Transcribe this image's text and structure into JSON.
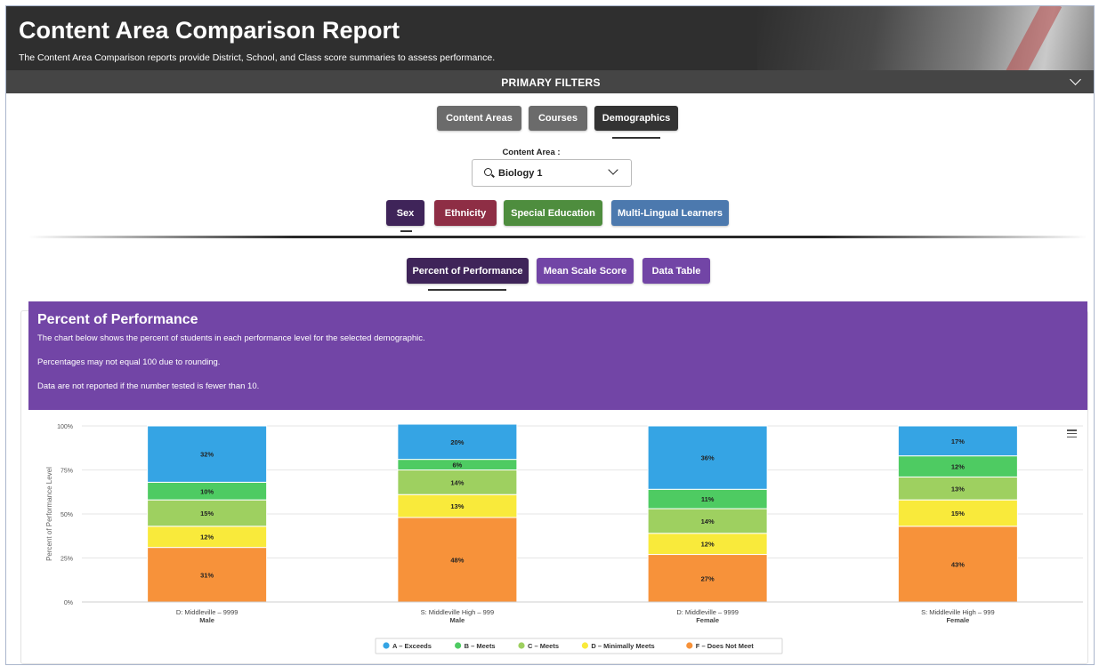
{
  "header": {
    "title": "Content Area Comparison Report",
    "subtitle": "The Content Area Comparison reports provide District, School, and Class score summaries to assess performance."
  },
  "filters": {
    "label": "PRIMARY FILTERS"
  },
  "tabs": {
    "content_areas": "Content Areas",
    "courses": "Courses",
    "demographics": "Demographics"
  },
  "content_area": {
    "label": "Content Area :",
    "selected": "Biology 1"
  },
  "demographic_buttons": {
    "sex": "Sex",
    "ethnicity": "Ethnicity",
    "special_education": "Special Education",
    "mll": "Multi-Lingual Learners"
  },
  "view_buttons": {
    "percent": "Percent of Performance",
    "mean": "Mean Scale Score",
    "table": "Data Table"
  },
  "info": {
    "title": "Percent of Performance",
    "line1": "The chart below shows the percent of students in each performance level for the selected demographic.",
    "line2": "Percentages may not equal 100 due to rounding.",
    "line3": "Data are not reported if the number tested is fewer than 10."
  },
  "colors": {
    "purple_dark": "#3f2459",
    "purple": "#7245a6",
    "grey_button": "#6b6b6b",
    "ethnicity": "#8e2e45",
    "special_education": "#4e8d3e",
    "mll": "#4c79ae"
  },
  "chart_data": {
    "type": "bar",
    "stacked": true,
    "ylabel": "Percent of Performance Level",
    "ylim": [
      0,
      100
    ],
    "yticks": [
      "0%",
      "25%",
      "50%",
      "75%",
      "100%"
    ],
    "categories": [
      {
        "line1": "D: Middleville – 9999",
        "line2": "Male"
      },
      {
        "line1": "S: Middleville High – 999",
        "line2": "Male"
      },
      {
        "line1": "D: Middleville – 9999",
        "line2": "Female"
      },
      {
        "line1": "S: Middleville High – 999",
        "line2": "Female"
      }
    ],
    "series": [
      {
        "name": "F – Does Not Meet",
        "color": "#f7923a",
        "values": [
          31,
          48,
          27,
          43
        ]
      },
      {
        "name": "D – Minimally Meets",
        "color": "#f9ea3b",
        "values": [
          12,
          13,
          12,
          15
        ]
      },
      {
        "name": "C – Meets",
        "color": "#9ed060",
        "values": [
          15,
          14,
          14,
          13
        ]
      },
      {
        "name": "B – Meets",
        "color": "#4ecb62",
        "values": [
          10,
          6,
          11,
          12
        ]
      },
      {
        "name": "A – Exceeds",
        "color": "#35a4e4",
        "values": [
          32,
          20,
          36,
          17
        ]
      }
    ],
    "legend_order": [
      "A – Exceeds",
      "B – Meets",
      "C – Meets",
      "D – Minimally Meets",
      "F – Does Not Meet"
    ],
    "legend_position": "bottom-center"
  }
}
